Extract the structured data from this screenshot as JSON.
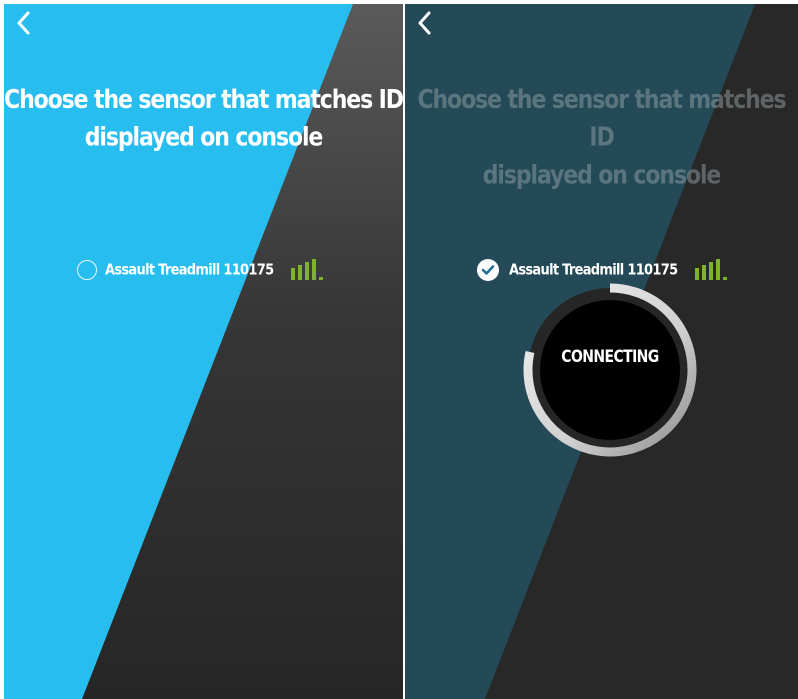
{
  "screens": [
    {
      "title_line1": "Choose the sensor that matches ID",
      "title_line2": "displayed on console",
      "sensor": {
        "label": "Assault Treadmill 110175",
        "selected": false
      }
    },
    {
      "title_line1": "Choose the sensor that matches ID",
      "title_line2": "displayed on console",
      "sensor": {
        "label": "Assault Treadmill 110175",
        "selected": true
      },
      "status": "CONNECTING"
    }
  ],
  "icons": {
    "back": "chevron-left-icon",
    "unselected": "radio-empty-icon",
    "selected": "checkmark-circle-icon",
    "signal": "signal-strength-icon"
  },
  "colors": {
    "accent_blue": "#27bdef",
    "dark_bg": "#262626",
    "signal_green": "#7fb32d",
    "overlay_teal": "#244a58"
  }
}
